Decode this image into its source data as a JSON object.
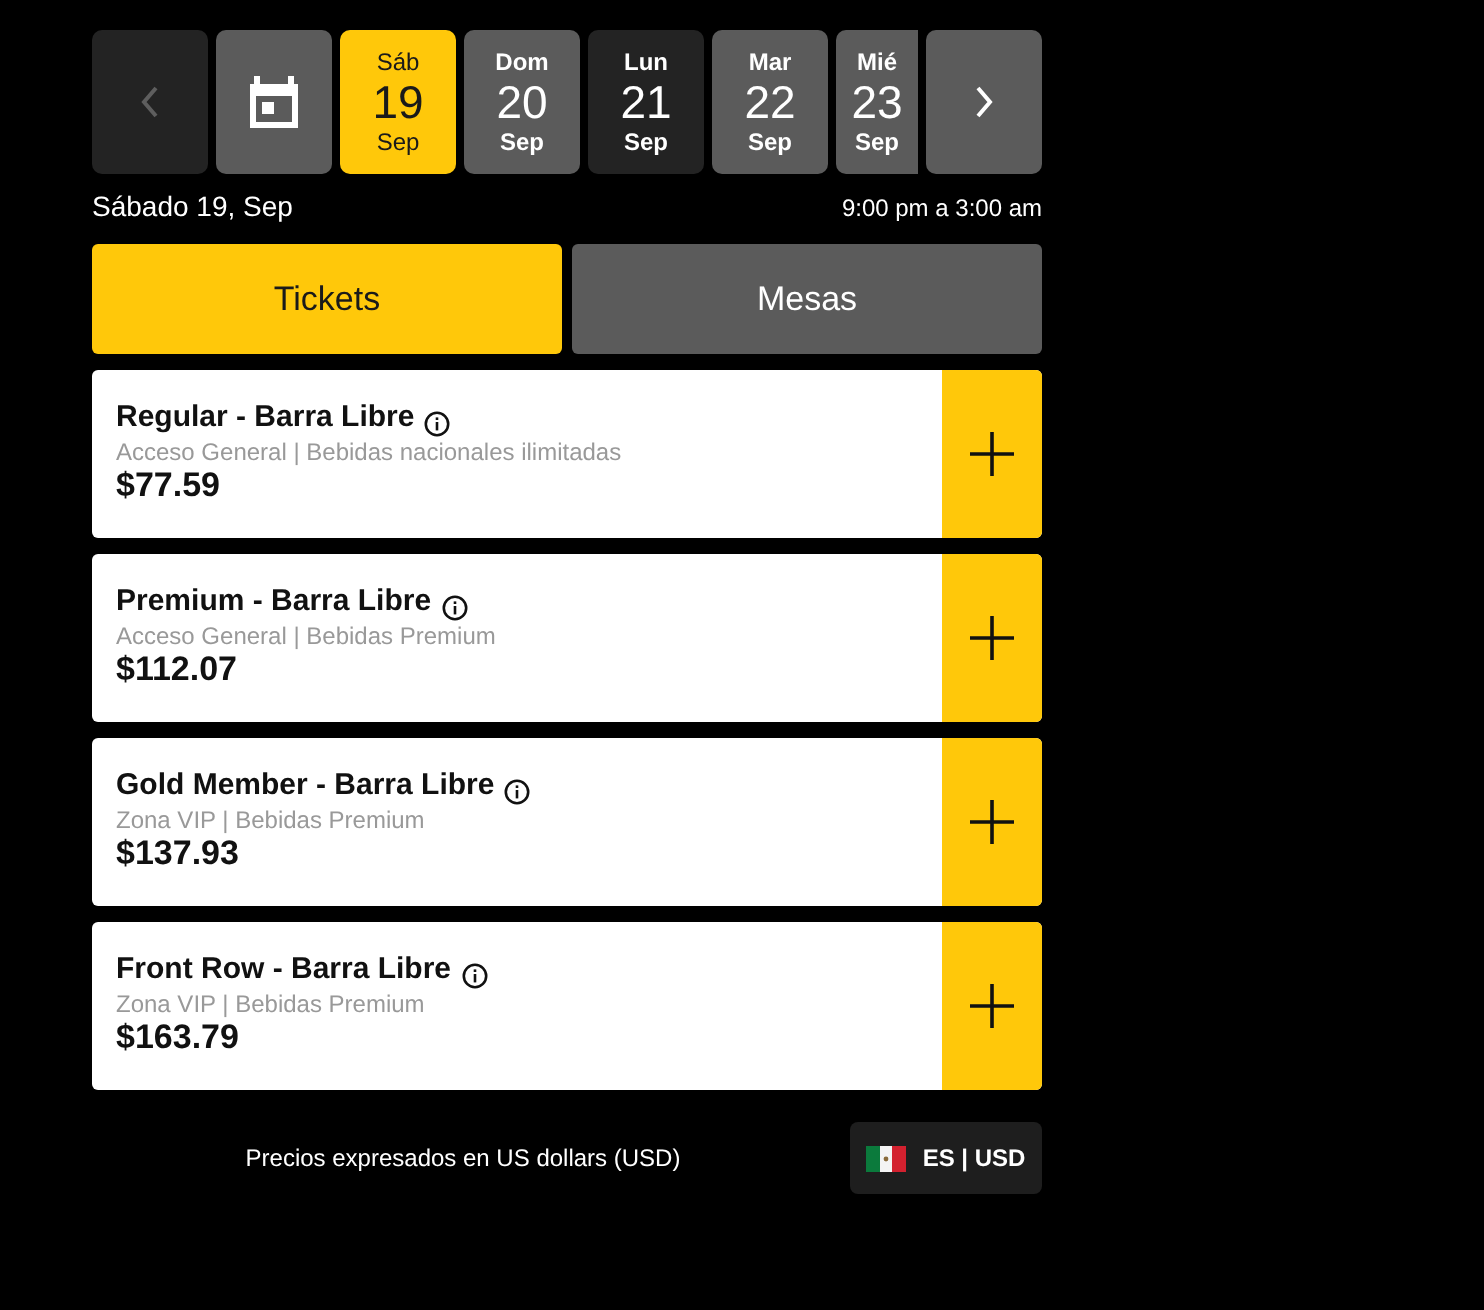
{
  "date_strip": {
    "prev_button": {
      "disabled": true
    },
    "next_button": {
      "disabled": false
    },
    "days": [
      {
        "weekday": "Sáb",
        "day": "19",
        "month": "Sep",
        "selected": true,
        "disabled": false
      },
      {
        "weekday": "Dom",
        "day": "20",
        "month": "Sep",
        "selected": false,
        "disabled": false
      },
      {
        "weekday": "Lun",
        "day": "21",
        "month": "Sep",
        "selected": false,
        "disabled": true
      },
      {
        "weekday": "Mar",
        "day": "22",
        "month": "Sep",
        "selected": false,
        "disabled": false
      },
      {
        "weekday": "Mié",
        "day": "23",
        "month": "Sep",
        "selected": false,
        "disabled": false
      }
    ]
  },
  "selected_date": "Sábado 19, Sep",
  "hours": "9:00 pm a 3:00 am",
  "tabs": [
    {
      "label": "Tickets",
      "selected": true
    },
    {
      "label": "Mesas",
      "selected": false
    }
  ],
  "tickets": [
    {
      "name": "Regular - Barra Libre",
      "description": "Acceso General | Bebidas nacionales ilimitadas",
      "price": "$77.59"
    },
    {
      "name": "Premium - Barra Libre",
      "description": "Acceso General | Bebidas Premium",
      "price": "$112.07"
    },
    {
      "name": "Gold Member - Barra Libre",
      "description": "Zona VIP | Bebidas Premium",
      "price": "$137.93"
    },
    {
      "name": "Front Row - Barra Libre",
      "description": "Zona VIP | Bebidas Premium",
      "price": "$163.79"
    }
  ],
  "footer": {
    "note": "Precios expresados en US dollars (USD)",
    "locale": "ES | USD"
  }
}
